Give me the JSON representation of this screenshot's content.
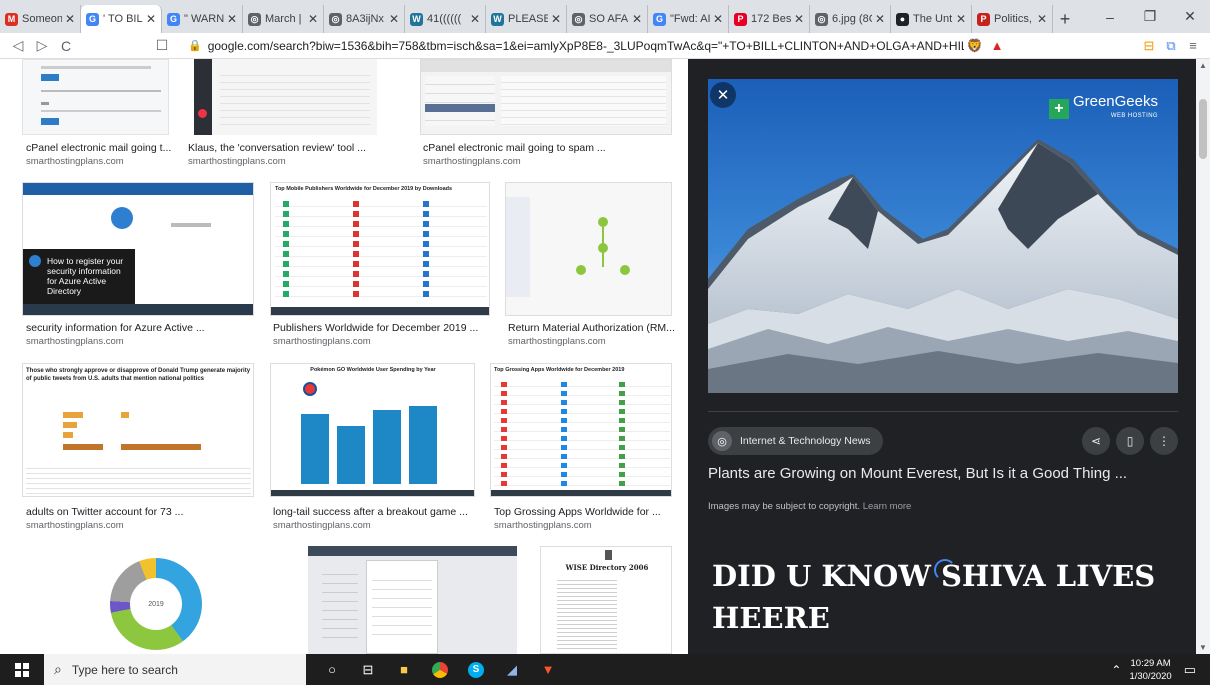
{
  "tabs": [
    {
      "icon": "gmail-icon",
      "title": "Someon",
      "color": "#d93025",
      "glyph": "M"
    },
    {
      "icon": "google-icon",
      "title": "' TO BILL",
      "color": "#4285f4",
      "glyph": "G",
      "active": true
    },
    {
      "icon": "google-icon",
      "title": "\" WARN",
      "color": "#4285f4",
      "glyph": "G"
    },
    {
      "icon": "globe-icon",
      "title": "March |",
      "color": "#5f6368",
      "glyph": "◎"
    },
    {
      "icon": "globe-icon",
      "title": "8A3ijNx",
      "color": "#5f6368",
      "glyph": "◎"
    },
    {
      "icon": "wordpress-icon",
      "title": "41((((((",
      "color": "#21759b",
      "glyph": "W"
    },
    {
      "icon": "wordpress-icon",
      "title": "PLEASE",
      "color": "#21759b",
      "glyph": "W"
    },
    {
      "icon": "globe-icon",
      "title": "SO AFA",
      "color": "#5f6368",
      "glyph": "◎"
    },
    {
      "icon": "google-icon",
      "title": "\"Fwd: AI",
      "color": "#4285f4",
      "glyph": "G"
    },
    {
      "icon": "pinterest-icon",
      "title": "172 Bes",
      "color": "#e60023",
      "glyph": "P"
    },
    {
      "icon": "globe-icon",
      "title": "6.jpg (8C",
      "color": "#5f6368",
      "glyph": "◎"
    },
    {
      "icon": "news-icon",
      "title": "The Unt",
      "color": "#202124",
      "glyph": "●"
    },
    {
      "icon": "politics-icon",
      "title": "Politics,",
      "color": "#c5221f",
      "glyph": "P"
    }
  ],
  "window_controls": {
    "minimize": "–",
    "maximize": "❐",
    "close": "✕"
  },
  "nav": {
    "back": "◁",
    "forward": "▷",
    "reload": "C",
    "bookmark": "☐"
  },
  "address": {
    "url": "google.com/search?biw=1536&bih=758&tbm=isch&sa=1&ei=amlyXpP8E8-_3LUPoqmTwAc&q=\"+TO+BILL+CLINTON+AND+OLGA+AND+HILLARY+C..."
  },
  "results": [
    {
      "caption": "cPanel electronic mail going t...",
      "source": "smarthostingplans.com"
    },
    {
      "caption": "Klaus, the 'conversation review' tool ...",
      "source": "smarthostingplans.com"
    },
    {
      "caption": "cPanel electronic mail going to spam ...",
      "source": "smarthostingplans.com"
    },
    {
      "caption": "security information for Azure Active ...",
      "source": "smarthostingplans.com",
      "overlay": "How to register your security information for Azure Active Directory"
    },
    {
      "caption": "Publishers Worldwide for December 2019 ...",
      "source": "smarthostingplans.com",
      "heading": "Top Mobile Publishers Worldwide for December 2019 by Downloads"
    },
    {
      "caption": "Return Material Authorization (RM...",
      "source": "smarthostingplans.com"
    },
    {
      "caption": "adults on Twitter account for 73 ...",
      "source": "smarthostingplans.com",
      "heading": "Those who strongly approve or disapprove of Donald Trump generate majority of public tweets from U.S. adults that mention national politics"
    },
    {
      "caption": "long-tail success after a breakout game ...",
      "source": "smarthostingplans.com",
      "heading": "Pokémon GO Worldwide User Spending by Year"
    },
    {
      "caption": "Top Grossing Apps Worldwide for ...",
      "source": "smarthostingplans.com",
      "heading": "Top Grossing Apps Worldwide for December 2019"
    },
    {
      "caption": "",
      "source": "",
      "center": "2019"
    },
    {
      "caption": "",
      "source": ""
    },
    {
      "caption": "",
      "source": "",
      "heading": "WISE Directory 2006"
    }
  ],
  "panel": {
    "close": "✕",
    "brand": "GreenGeeks",
    "brand_sub": "WEB HOSTING",
    "chip": "Internet & Technology News",
    "title": "Plants are Growing on Mount Everest, But Is it a Good Thing ...",
    "copyright": "Images may be subject to copyright.",
    "learn_more": "Learn more",
    "overlay_text": "DID U KNOW SHIVA LIVES HEERE"
  },
  "taskbar": {
    "search_placeholder": "Type here to search",
    "time": "10:29 AM",
    "date": "1/30/2020"
  }
}
